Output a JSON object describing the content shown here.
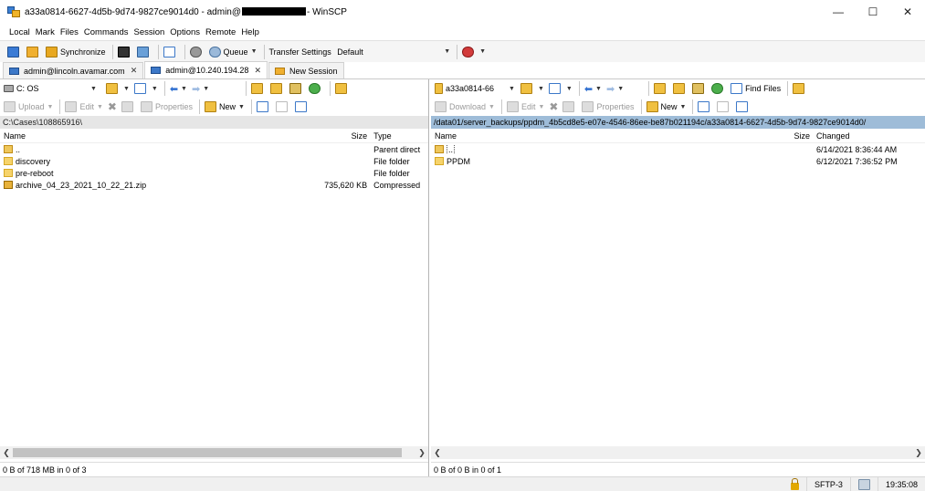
{
  "window": {
    "title_prefix": "a33a0814-6627-4d5b-9d74-9827ce9014d0 - admin@",
    "title_suffix": "- WinSCP",
    "minimize_glyph": "—",
    "maximize_glyph": "☐",
    "close_glyph": "✕"
  },
  "menu": [
    "Local",
    "Mark",
    "Files",
    "Commands",
    "Session",
    "Options",
    "Remote",
    "Help"
  ],
  "toolbar": {
    "synchronize": "Synchronize",
    "queue": "Queue",
    "transfer_settings_label": "Transfer Settings",
    "transfer_settings_value": "Default"
  },
  "tabs": [
    {
      "label": "admin@lincoln.avamar.com",
      "close": "✕"
    },
    {
      "label": "admin@10.240.194.28",
      "close": "✕"
    },
    {
      "label": "New Session"
    }
  ],
  "left": {
    "drive": "C: OS",
    "upload": "Upload",
    "edit": "Edit",
    "properties": "Properties",
    "new": "New",
    "path": "C:\\Cases\\108865916\\",
    "columns": {
      "name": "Name",
      "size": "Size",
      "type": "Type"
    },
    "files": [
      {
        "name": "..",
        "size": "",
        "type": "Parent direct",
        "icon": "parent"
      },
      {
        "name": "discovery",
        "size": "",
        "type": "File folder",
        "icon": "folder"
      },
      {
        "name": "pre-reboot",
        "size": "",
        "type": "File folder",
        "icon": "folder"
      },
      {
        "name": "archive_04_23_2021_10_22_21.zip",
        "size": "735,620 KB",
        "type": "Compressed",
        "icon": "zip"
      }
    ],
    "status": "0 B of 718 MB in 0 of 3"
  },
  "right": {
    "drive": "a33a0814-66",
    "download": "Download",
    "edit": "Edit",
    "properties": "Properties",
    "new": "New",
    "find_files": "Find Files",
    "path": "/data01/server_backups/ppdm_4b5cd8e5-e07e-4546-86ee-be87b021194c/a33a0814-6627-4d5b-9d74-9827ce9014d0/",
    "columns": {
      "name": "Name",
      "size": "Size",
      "changed": "Changed"
    },
    "files": [
      {
        "name": "..",
        "size": "",
        "changed": "6/14/2021 8:36:44 AM",
        "icon": "parent"
      },
      {
        "name": "PPDM",
        "size": "",
        "changed": "6/12/2021 7:36:52 PM",
        "icon": "folder"
      }
    ],
    "status": "0 B of 0 B in 0 of 1"
  },
  "statusbar": {
    "protocol": "SFTP-3",
    "time": "19:35:08"
  }
}
